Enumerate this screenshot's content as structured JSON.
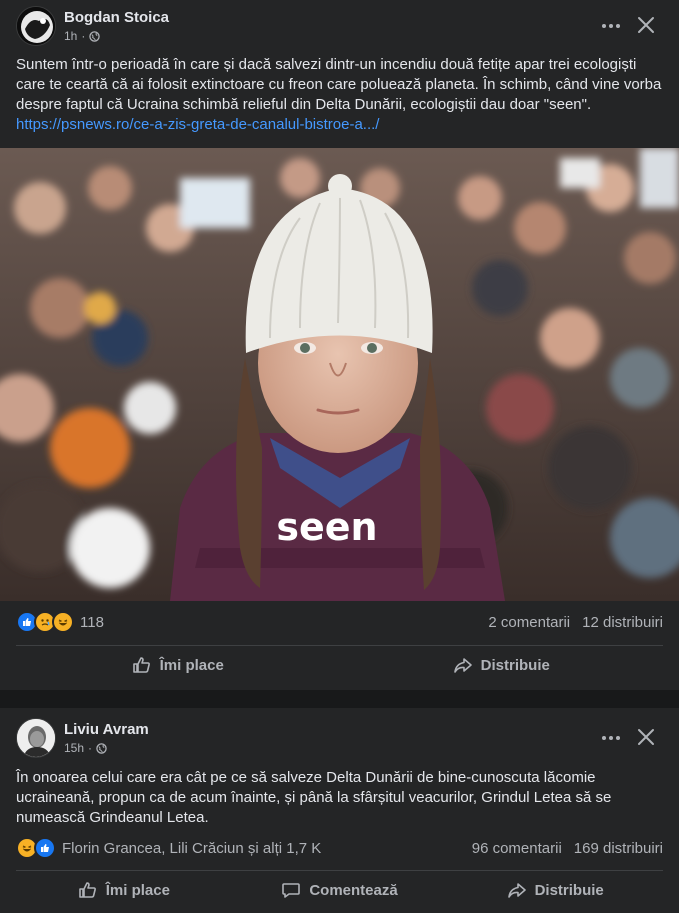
{
  "post1": {
    "author": "Bogdan Stoica",
    "time": "1h",
    "text": "Suntem într-o perioadă în care și dacă salvezi dintr-un incendiu două fetițe apar trei ecologiști care te ceartă că ai folosit extinctoare cu freon care poluează planeta. În schimb, când vine vorba despre faptul că Ucraina schimbă relieful din Delta Dunării, ecologiștii dau doar \"seen\".",
    "link": "https://psnews.ro/ce-a-zis-greta-de-canalul-bistroe-a.../",
    "image_caption": "seen",
    "reaction_count": "118",
    "comments": "2 comentarii",
    "shares": "12 distribuiri",
    "like_label": "Îmi place",
    "share_label": "Distribuie",
    "reaction_icons": [
      "like-icon",
      "sad-icon",
      "haha-icon"
    ]
  },
  "post2": {
    "author": "Liviu Avram",
    "time": "15h",
    "text": "În onoarea celui care era cât pe ce să salveze Delta Dunării de bine-cunoscuta lăcomie ucraineană, propun ca de acum înainte, și până la sfârșitul veacurilor, Grindul Letea să se numească Grindeanul Letea.",
    "reactors": "Florin Grancea, Lili Crăciun și alți 1,7 K",
    "comments": "96 comentarii",
    "shares": "169 distribuiri",
    "like_label": "Îmi place",
    "comment_label": "Comentează",
    "share_label": "Distribuie",
    "reaction_icons": [
      "haha-icon",
      "like-icon"
    ]
  },
  "colors": {
    "background": "#18191a",
    "card": "#242526",
    "link": "#4599ff",
    "like_blue": "#1877f2",
    "reaction_yellow": "#f7b125"
  }
}
